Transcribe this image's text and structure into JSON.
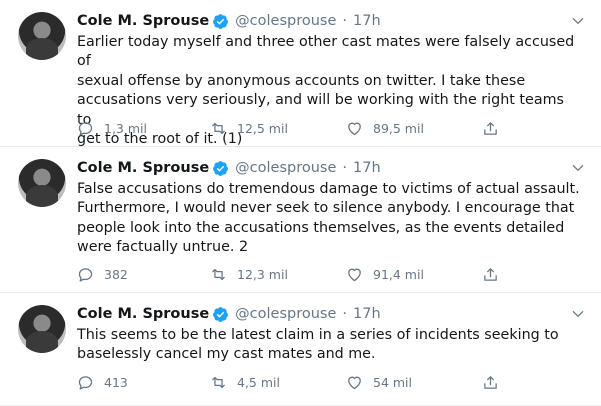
{
  "tweets": [
    {
      "name": "Cole M. Sprouse",
      "handle": "@colesprouse",
      "separator": "·",
      "time": "17h",
      "text": "Earlier today myself and three other cast mates were falsely accused of\nsexual offense by anonymous accounts on twitter. I take these\naccusations very seriously, and will be working with the right teams to\nget to the root of it. (1)",
      "replies": "1,3 mil",
      "retweets": "12,5 mil",
      "likes": "89,5 mil"
    },
    {
      "name": "Cole M. Sprouse",
      "handle": "@colesprouse",
      "separator": "·",
      "time": "17h",
      "text": "False accusations do tremendous damage to victims of actual assault.\nFurthermore, I would never seek to silence anybody. I encourage that\npeople look into the accusations themselves, as the events detailed\nwere factually untrue. 2",
      "replies": "382",
      "retweets": "12,3 mil",
      "likes": "91,4 mil"
    },
    {
      "name": "Cole M. Sprouse",
      "handle": "@colesprouse",
      "separator": "·",
      "time": "17h",
      "text": "This seems to be the latest claim in a series of incidents seeking to\nbaselessly cancel my cast mates and me.",
      "replies": "413",
      "retweets": "4,5 mil",
      "likes": "54 mil"
    }
  ],
  "colors": {
    "verified": "#1da1f2",
    "muted": "#657786",
    "text": "#14171a",
    "divider": "#e6ecf0"
  },
  "icons": [
    "verified-badge-icon",
    "chevron-down-icon",
    "reply-icon",
    "retweet-icon",
    "like-icon",
    "share-icon"
  ]
}
